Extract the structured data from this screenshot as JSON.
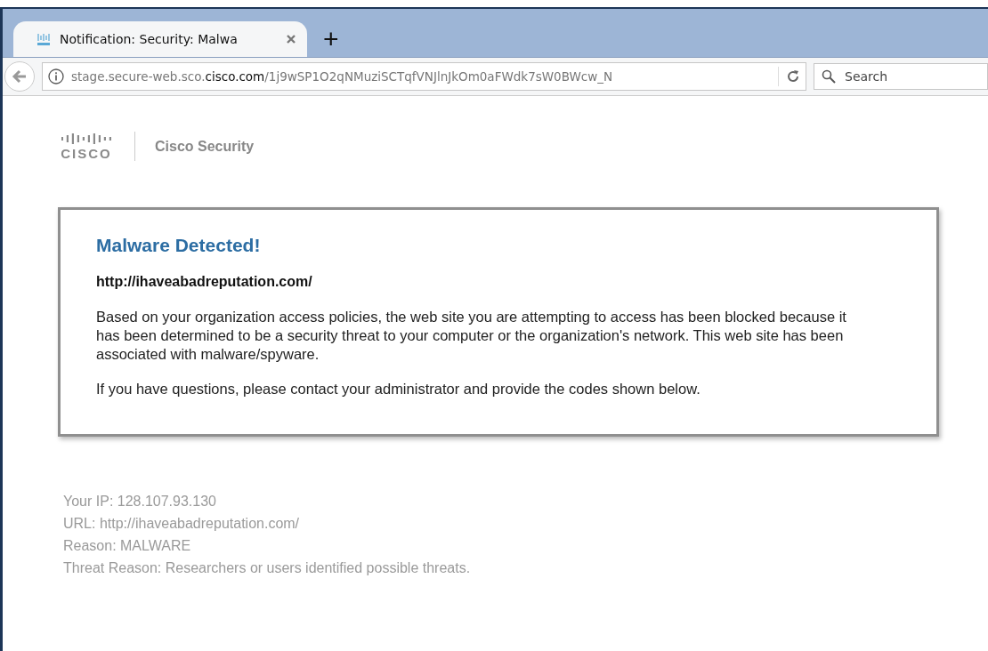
{
  "browser": {
    "tab": {
      "title": "Notification: Security: Malwa",
      "selected": true
    },
    "new_tab": "+",
    "address": "stage.secure-web.sco.**cisco.com**/1j9wSP1O2qNMuziSCTqfVNJlnJkOm0aFWdk7sW0BWcw_N",
    "search": {
      "placeholder": "Search"
    }
  },
  "header": {
    "logo_text": "CISCO",
    "product": "Cisco Security"
  },
  "alert": {
    "title": "Malware Detected!",
    "url": "http://ihaveabadreputation.com/",
    "paragraphs": [
      "Based on your organization access policies, the web site you are attempting to access has been blocked because it has been determined to be a security threat to your computer or the organization's network. This web site has been associated with malware/spyware.",
      "If you have questions, please contact your administrator and provide the codes shown below."
    ]
  },
  "details": [
    "Your IP: 128.107.93.130",
    "URL: http://ihaveabadreputation.com/",
    "Reason: MALWARE",
    "Threat Reason: Researchers or users identified possible threats."
  ]
}
